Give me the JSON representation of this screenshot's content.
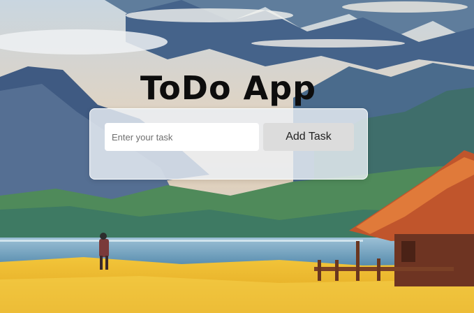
{
  "app": {
    "title": "ToDo App"
  },
  "form": {
    "input_placeholder": "Enter your task",
    "input_value": "",
    "add_button_label": "Add Task"
  },
  "colors": {
    "title": "#0d0d0d",
    "card_background": "#ebf0f6",
    "button_background": "#dcdcdc",
    "input_background": "#ffffff"
  }
}
